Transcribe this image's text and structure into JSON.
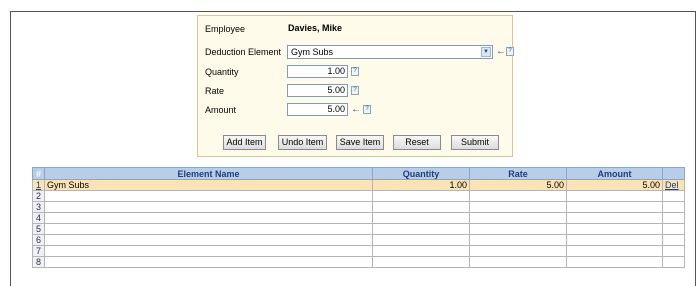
{
  "form": {
    "employee_label": "Employee",
    "employee_name": "Davies, Mike",
    "deduction_label": "Deduction Element",
    "deduction_value": "Gym Subs",
    "quantity_label": "Quantity",
    "quantity_value": "1.00",
    "rate_label": "Rate",
    "rate_value": "5.00",
    "amount_label": "Amount",
    "amount_value": "5.00",
    "help_glyph": "?",
    "calc_glyph": "←",
    "dropdown_glyph": "▼"
  },
  "buttons": {
    "add_item": "Add Item",
    "undo_item": "Undo Item",
    "save_item": "Save Item",
    "reset": "Reset",
    "submit": "Submit"
  },
  "table": {
    "headers": {
      "index": "#",
      "element_name": "Element Name",
      "quantity": "Quantity",
      "rate": "Rate",
      "amount": "Amount"
    },
    "rows": [
      {
        "index": "1",
        "element_name": "Gym Subs",
        "quantity": "1.00",
        "rate": "5.00",
        "amount": "5.00",
        "action": "Del"
      },
      {
        "index": "2",
        "element_name": "",
        "quantity": "",
        "rate": "",
        "amount": "",
        "action": ""
      },
      {
        "index": "3",
        "element_name": "",
        "quantity": "",
        "rate": "",
        "amount": "",
        "action": ""
      },
      {
        "index": "4",
        "element_name": "",
        "quantity": "",
        "rate": "",
        "amount": "",
        "action": ""
      },
      {
        "index": "5",
        "element_name": "",
        "quantity": "",
        "rate": "",
        "amount": "",
        "action": ""
      },
      {
        "index": "6",
        "element_name": "",
        "quantity": "",
        "rate": "",
        "amount": "",
        "action": ""
      },
      {
        "index": "7",
        "element_name": "",
        "quantity": "",
        "rate": "",
        "amount": "",
        "action": ""
      },
      {
        "index": "8",
        "element_name": "",
        "quantity": "",
        "rate": "",
        "amount": "",
        "action": ""
      }
    ]
  },
  "colors": {
    "panel_bg": "#fffbea",
    "header_bg": "#b8cde8",
    "selected_row_bg": "#fbe3b5",
    "link_color": "#1f3f7a"
  }
}
